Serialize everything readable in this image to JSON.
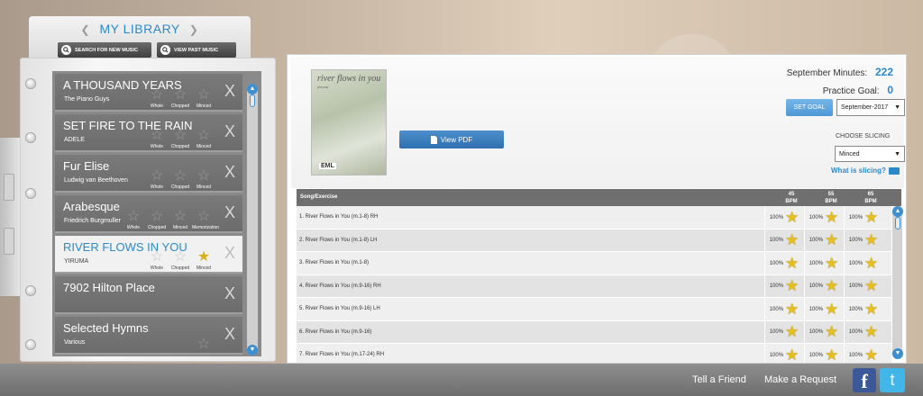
{
  "library": {
    "title": "MY LIBRARY",
    "search_label": "SEARCH FOR NEW MUSIC",
    "past_label": "VIEW PAST MUSIC",
    "remove_glyph": "X",
    "songs": [
      {
        "title": "A THOUSAND YEARS",
        "artist": "The Piano Guys",
        "stars": [
          {
            "label": "Whole",
            "on": false
          },
          {
            "label": "Chopped",
            "on": false
          },
          {
            "label": "Minced",
            "on": false
          }
        ]
      },
      {
        "title": "SET FIRE TO THE RAIN",
        "artist": "ADELE",
        "stars": [
          {
            "label": "Whole",
            "on": false
          },
          {
            "label": "Chopped",
            "on": false
          },
          {
            "label": "Minced",
            "on": false
          }
        ]
      },
      {
        "title": "Fur Elise",
        "artist": "Ludwig van Beethoven",
        "stars": [
          {
            "label": "Whole",
            "on": false
          },
          {
            "label": "Chopped",
            "on": false
          },
          {
            "label": "Minced",
            "on": false
          }
        ]
      },
      {
        "title": "Arabesque",
        "artist": "Friedrich Burgmuller",
        "stars": [
          {
            "label": "Whole",
            "on": false
          },
          {
            "label": "Chopped",
            "on": false
          },
          {
            "label": "Minced",
            "on": false
          },
          {
            "label": "Memorization",
            "on": false
          }
        ]
      },
      {
        "title": "RIVER FLOWS IN YOU",
        "artist": "YIRUMA",
        "active": true,
        "stars": [
          {
            "label": "Whole",
            "on": false
          },
          {
            "label": "Chopped",
            "on": false
          },
          {
            "label": "Minced",
            "on": true
          }
        ]
      },
      {
        "title": "7902 Hilton Place",
        "artist": "",
        "stars": []
      },
      {
        "title": "Selected Hymns",
        "artist": "Various",
        "stars": [
          {
            "label": "",
            "on": false
          }
        ]
      }
    ]
  },
  "detail": {
    "cover": {
      "title": "river flows in you",
      "subtitle": "yiruma",
      "logo": "EML"
    },
    "view_pdf_label": "View PDF",
    "minutes_label": "September Minutes:",
    "minutes_value": "222",
    "goal_label": "Practice Goal:",
    "goal_value": "0",
    "set_goal_label": "SET GOAL",
    "month_value": "September-2017",
    "slicing_label": "CHOOSE SLICING",
    "slicing_value": "Minced",
    "what_slicing": "What is slicing?",
    "table": {
      "song_header": "Song/Exercise",
      "bpms": [
        "45",
        "55",
        "65"
      ],
      "bpm_unit": "BPM",
      "rows": [
        {
          "name": "1. River Flows in You (m.1-8) RH",
          "pct": [
            "100%",
            "100%",
            "100%"
          ]
        },
        {
          "name": "2. River Flows in You (m.1-8) LH",
          "pct": [
            "100%",
            "100%",
            "100%"
          ]
        },
        {
          "name": "3. River Flows in You (m.1-8)",
          "pct": [
            "100%",
            "100%",
            "100%"
          ]
        },
        {
          "name": "4. River Flows in You (m.9-16) RH",
          "pct": [
            "100%",
            "100%",
            "100%"
          ]
        },
        {
          "name": "5. River Flows in You (m.9-16) LH",
          "pct": [
            "100%",
            "100%",
            "100%"
          ]
        },
        {
          "name": "6. River Flows in You (m.9-16)",
          "pct": [
            "100%",
            "100%",
            "100%"
          ]
        },
        {
          "name": "7. River Flows in You (m.17-24) RH",
          "pct": [
            "100%",
            "100%",
            "100%"
          ]
        }
      ]
    }
  },
  "footer": {
    "tell_friend": "Tell a Friend",
    "make_request": "Make a Request",
    "facebook_glyph": "f",
    "twitter_glyph": "t"
  },
  "icons": {
    "search": "search-icon",
    "star": "star-icon",
    "pdf": "document-icon",
    "video": "video-camera-icon",
    "facebook": "facebook-icon",
    "twitter": "twitter-icon"
  },
  "colors": {
    "accent": "#2d8ac8",
    "star_gold": "#e4bf1f",
    "footer": "#7e7e7e"
  }
}
